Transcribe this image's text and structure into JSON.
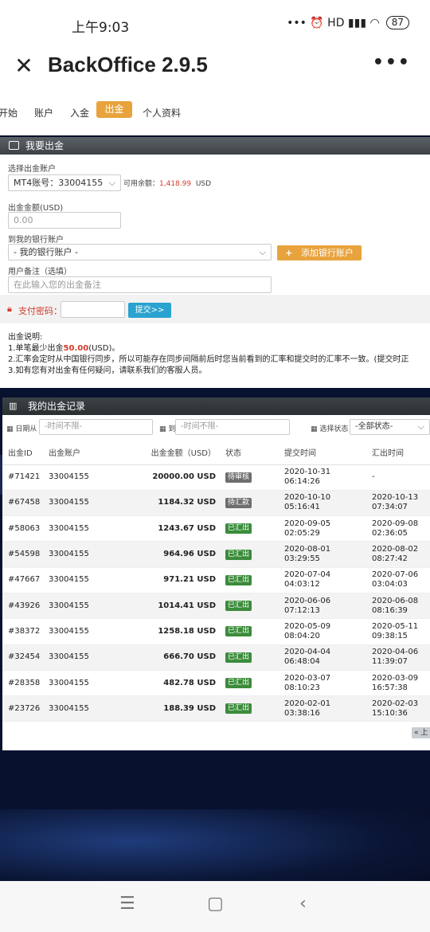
{
  "status_bar": {
    "time": "上午9:03",
    "signal_text": "••• ⏰ HD ▮▮▮ ◠",
    "battery": "87"
  },
  "app_bar": {
    "title": "BackOffice 2.9.5",
    "close_icon": "close-icon",
    "more_icon": "more-icon"
  },
  "nav": {
    "items": [
      "开始",
      "账户",
      "入金",
      "出金",
      "个人资料"
    ],
    "active": "出金"
  },
  "withdraw_form": {
    "header": "我要出金",
    "account_label": "选择出金账户",
    "account_value": "MT4账号：33004155",
    "available_label": "可用余额：",
    "available_value": "1,418.99",
    "available_currency": "USD",
    "amount_label": "出金金额(USD)",
    "amount_placeholder": "0.00",
    "bank_label": "到我的银行账户",
    "bank_value": "- 我的银行账户 -",
    "add_bank_button": "添加银行账户",
    "remark_label": "用户备注（选填）",
    "remark_placeholder": "在此输入您的出金备注",
    "password_label": "支付密码：",
    "submit_button": "提交>>"
  },
  "notes": {
    "title": "出金说明:",
    "line1_prefix": "1.单笔最少出金",
    "line1_amount": "50.00",
    "line1_suffix": "(USD)。",
    "line2": "2.汇率会定时从中国银行同步，所以可能存在同步间隔前后时您当前看到的汇率和提交时的汇率不一致。(提交时正",
    "line3": "3.如有您有对出金有任何疑问，请联系我们的客服人员。"
  },
  "records": {
    "header": "我的出金记录",
    "date_from_label": "日期从",
    "date_from_placeholder": "-时间不限-",
    "date_to_label": "到",
    "date_to_placeholder": "-时间不限-",
    "status_label": "选择状态",
    "status_value": "-全部状态-",
    "columns": [
      "出金ID",
      "出金账户",
      "出金金额（USD）",
      "状态",
      "提交时间",
      "汇出时间"
    ],
    "rows": [
      {
        "id": "#71421",
        "account": "33004155",
        "amount": "20000.00 USD",
        "status": "待审核",
        "submit": "2020-10-31\n06:14:26",
        "sent": "-"
      },
      {
        "id": "#67458",
        "account": "33004155",
        "amount": "1184.32 USD",
        "status": "待汇款",
        "submit": "2020-10-10\n05:16:41",
        "sent": "2020-10-13\n07:34:07"
      },
      {
        "id": "#58063",
        "account": "33004155",
        "amount": "1243.67 USD",
        "status": "已汇出",
        "submit": "2020-09-05\n02:05:29",
        "sent": "2020-09-08\n02:36:05"
      },
      {
        "id": "#54598",
        "account": "33004155",
        "amount": "964.96 USD",
        "status": "已汇出",
        "submit": "2020-08-01\n03:29:55",
        "sent": "2020-08-02\n08:27:42"
      },
      {
        "id": "#47667",
        "account": "33004155",
        "amount": "971.21 USD",
        "status": "已汇出",
        "submit": "2020-07-04\n04:03:12",
        "sent": "2020-07-06\n03:04:03"
      },
      {
        "id": "#43926",
        "account": "33004155",
        "amount": "1014.41 USD",
        "status": "已汇出",
        "submit": "2020-06-06\n07:12:13",
        "sent": "2020-06-08\n08:16:39"
      },
      {
        "id": "#38372",
        "account": "33004155",
        "amount": "1258.18 USD",
        "status": "已汇出",
        "submit": "2020-05-09\n08:04:20",
        "sent": "2020-05-11\n09:38:15"
      },
      {
        "id": "#32454",
        "account": "33004155",
        "amount": "666.70 USD",
        "status": "已汇出",
        "submit": "2020-04-04\n06:48:04",
        "sent": "2020-04-06\n11:39:07"
      },
      {
        "id": "#28358",
        "account": "33004155",
        "amount": "482.78 USD",
        "status": "已汇出",
        "submit": "2020-03-07\n08:10:23",
        "sent": "2020-03-09\n16:57:38"
      },
      {
        "id": "#23726",
        "account": "33004155",
        "amount": "188.39 USD",
        "status": "已汇出",
        "submit": "2020-02-01\n03:38:16",
        "sent": "2020-02-03\n15:10:36"
      }
    ],
    "prev_button": "« 上"
  },
  "colors": {
    "accent": "#e8a33d",
    "amount_green": "#2e8b1e",
    "balance_red": "#d13b2a",
    "submit_blue": "#2aa3d0"
  }
}
